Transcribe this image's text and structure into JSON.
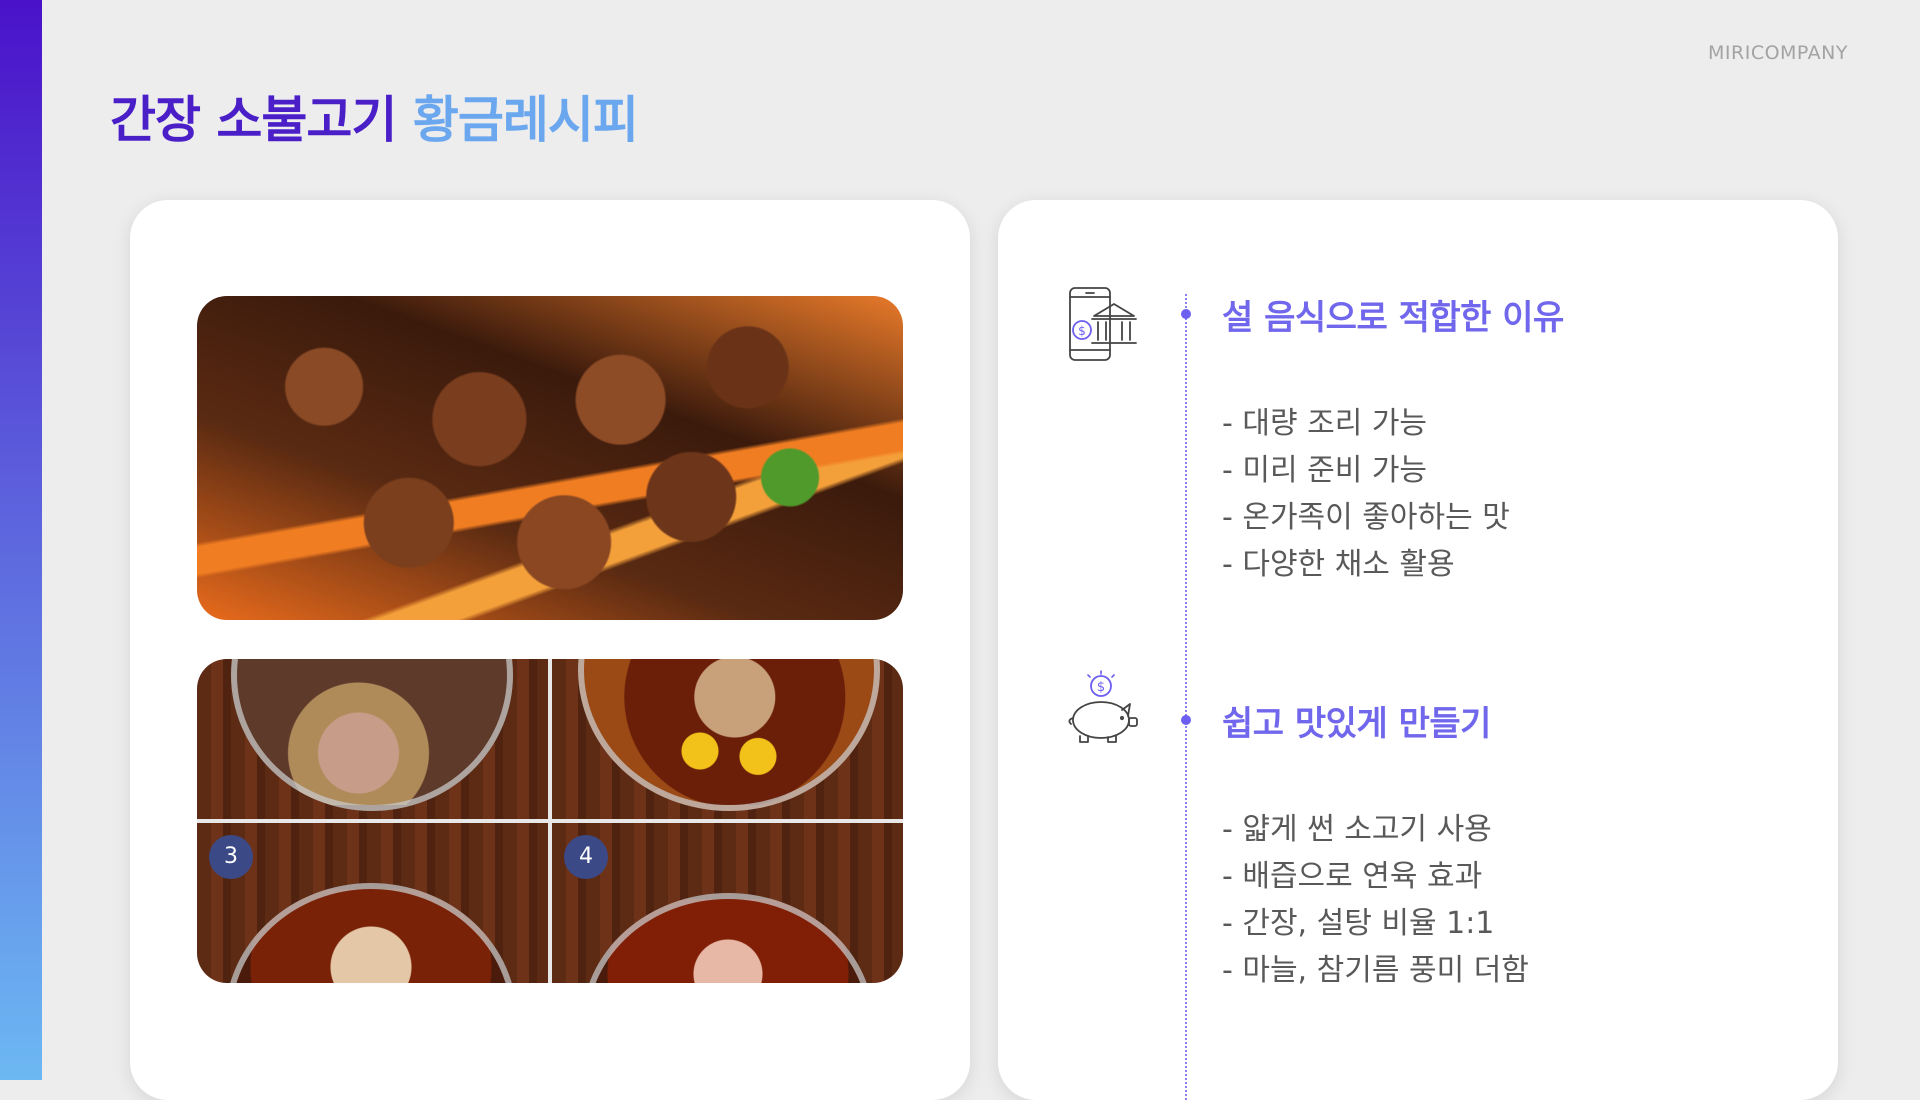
{
  "brand": "MIRICOMPANY",
  "title": {
    "part1": "간장 소불고기",
    "part2": "황금레시피"
  },
  "photos": {
    "step_badges": [
      "3",
      "4"
    ]
  },
  "sections": [
    {
      "icon": "mobile-bank-icon",
      "heading": "설 음식으로 적합한 이유",
      "items": [
        "- 대량 조리 가능",
        "- 미리 준비 가능",
        "- 온가족이 좋아하는 맛",
        "- 다양한 채소 활용"
      ]
    },
    {
      "icon": "piggy-bank-icon",
      "heading": "쉽고 맛있게 만들기",
      "items": [
        "- 얇게 썬 소고기 사용",
        "- 배즙으로 연육 효과",
        "- 간장, 설탕 비율 1:1",
        "- 마늘, 참기름 풍미 더함"
      ]
    }
  ],
  "colors": {
    "accent_dark": "#4a1fc8",
    "accent_light": "#6aa7ee",
    "heading": "#7167ec",
    "body_text": "#595959",
    "background": "#ededed"
  }
}
